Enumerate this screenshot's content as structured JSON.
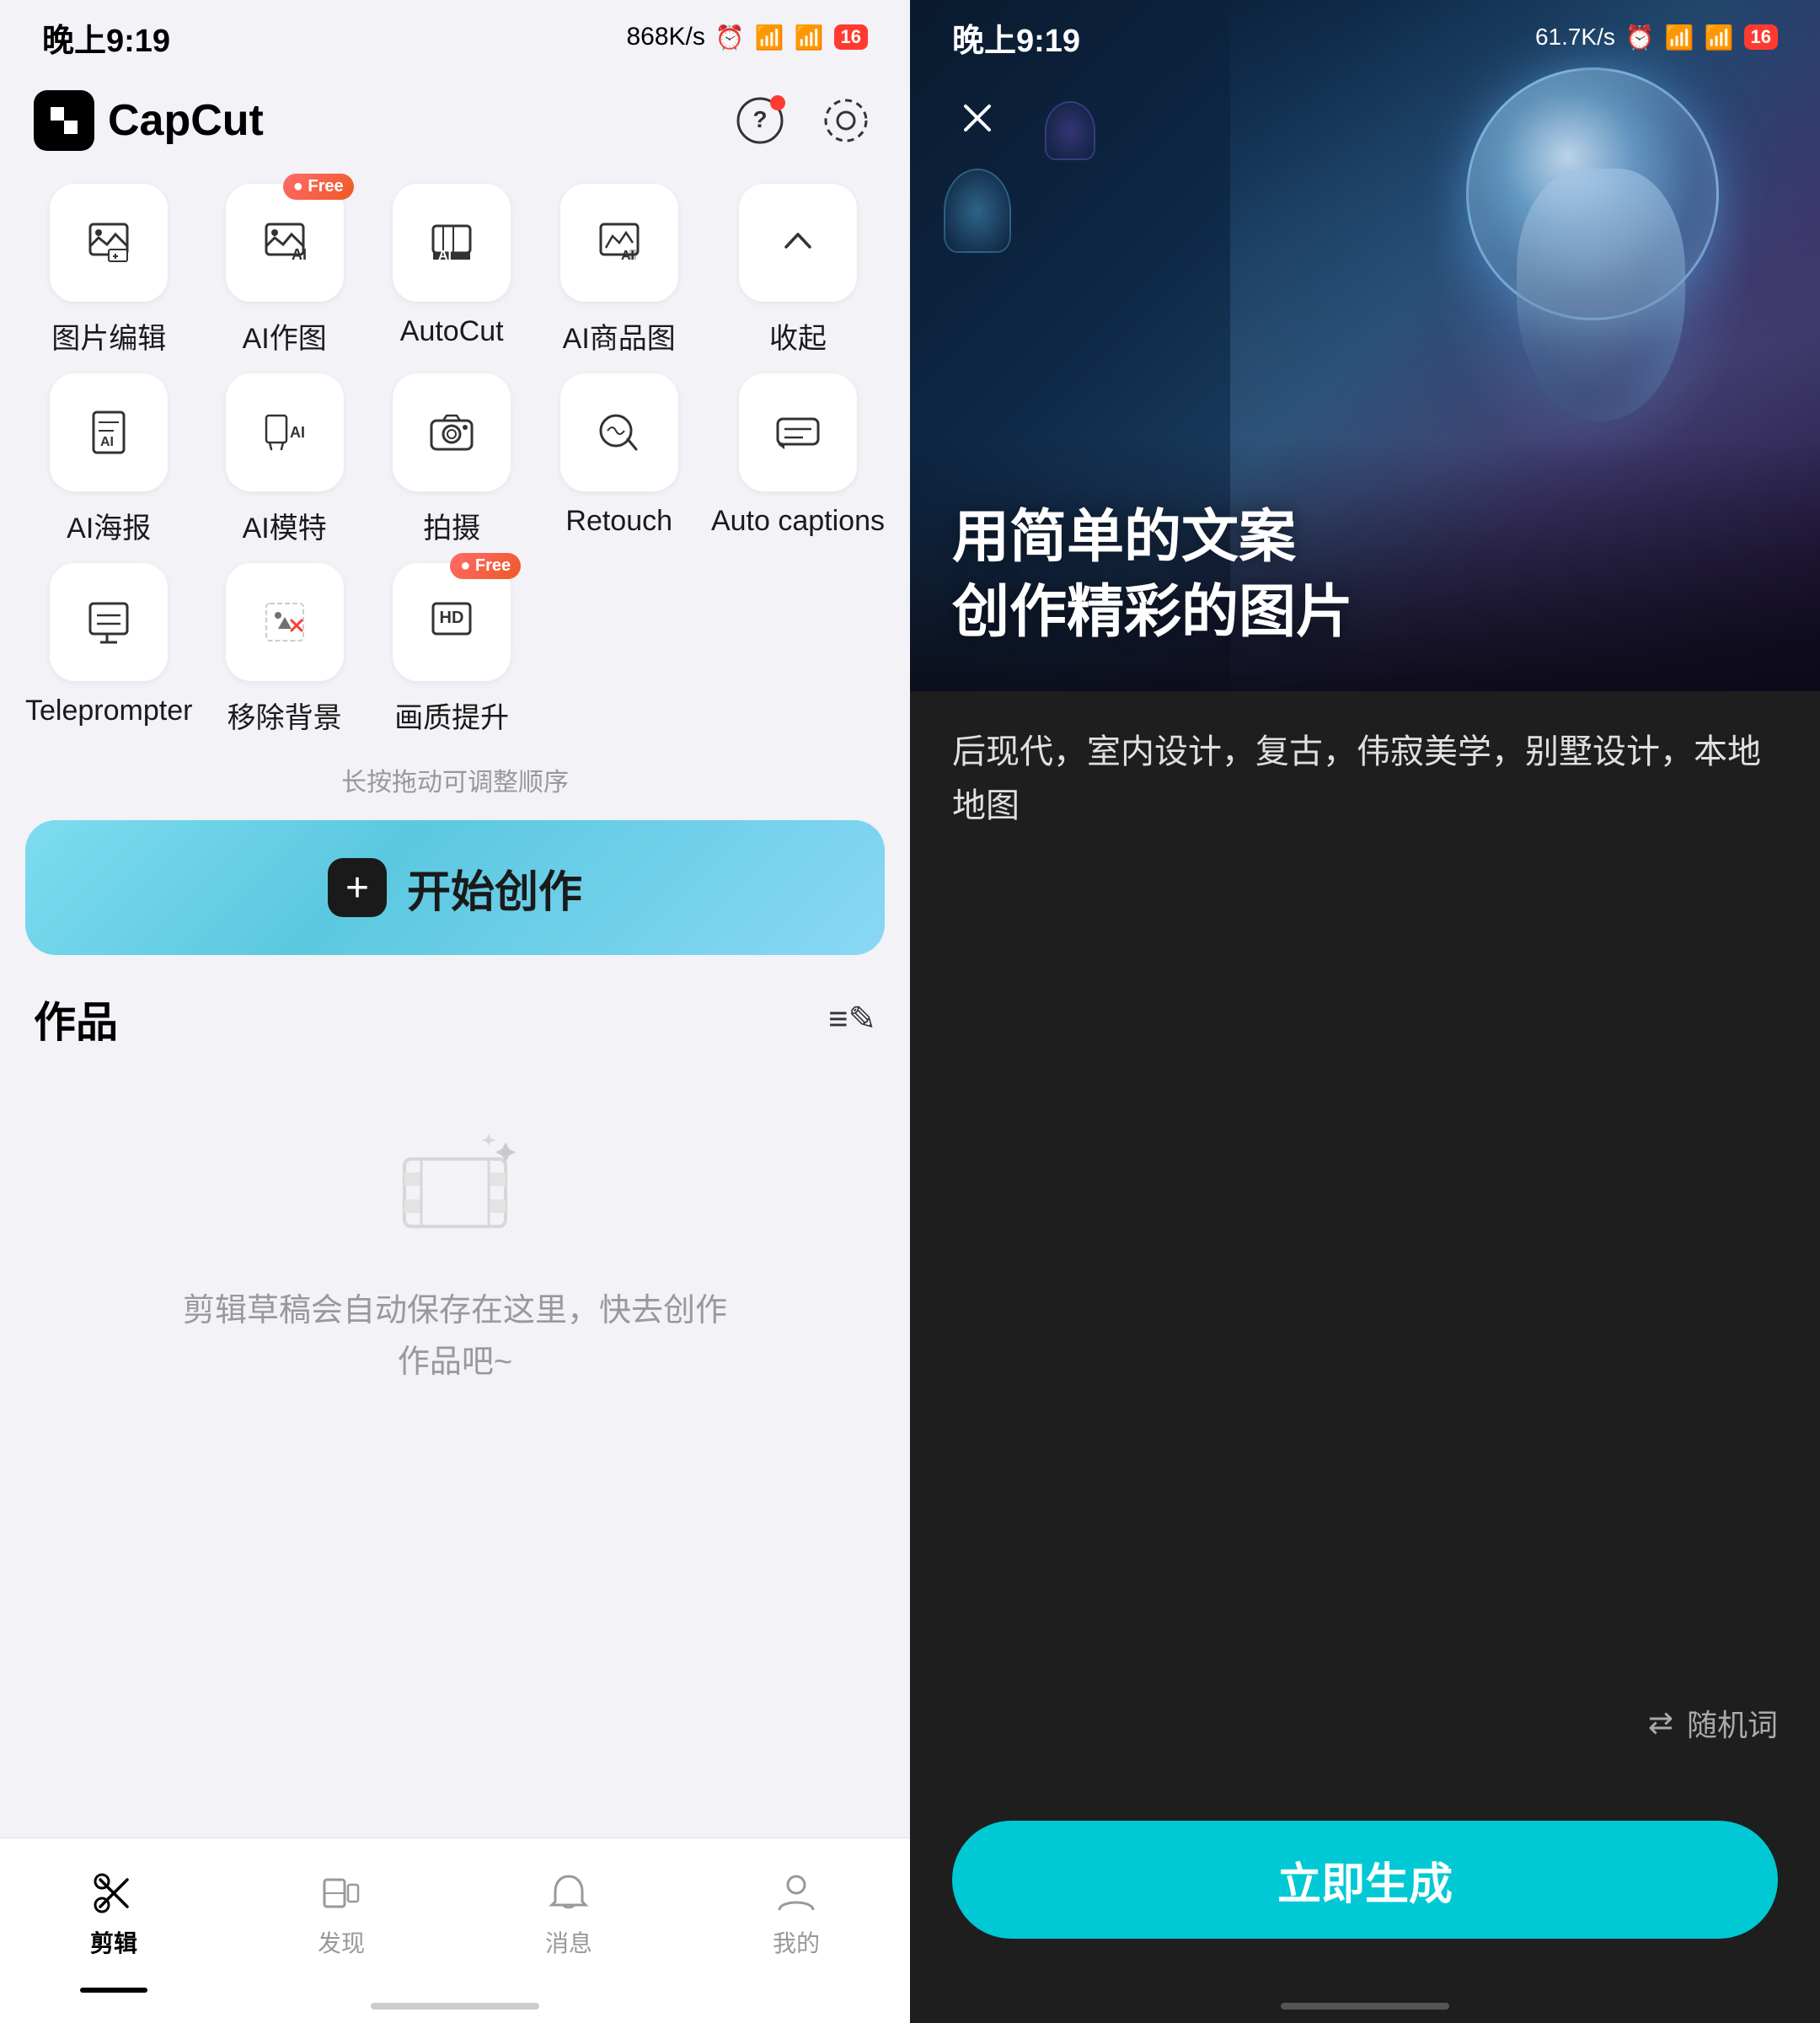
{
  "left": {
    "statusBar": {
      "time": "晚上9:19",
      "speed": "868K/s",
      "batteryBadge": "16"
    },
    "header": {
      "appName": "CapCut",
      "questionBtn": "?",
      "settingsBtn": "⊙"
    },
    "tools": [
      {
        "id": "image-edit",
        "label": "图片编辑",
        "icon": "image-edit",
        "free": false
      },
      {
        "id": "ai-painting",
        "label": "AI作图",
        "icon": "ai-painting",
        "free": true
      },
      {
        "id": "autocut",
        "label": "AutoCut",
        "icon": "autocut",
        "free": false
      },
      {
        "id": "ai-product",
        "label": "AI商品图",
        "icon": "ai-product",
        "free": false
      },
      {
        "id": "collapse",
        "label": "收起",
        "icon": "collapse",
        "free": false
      },
      {
        "id": "ai-poster",
        "label": "AI海报",
        "icon": "ai-poster",
        "free": false
      },
      {
        "id": "ai-model",
        "label": "AI模特",
        "icon": "ai-model",
        "free": false
      },
      {
        "id": "camera",
        "label": "拍摄",
        "icon": "camera",
        "free": false
      },
      {
        "id": "retouch",
        "label": "Retouch",
        "icon": "retouch",
        "free": false
      },
      {
        "id": "captions",
        "label": "Auto captions",
        "icon": "captions",
        "free": false
      },
      {
        "id": "teleprompter",
        "label": "Teleprompter",
        "icon": "teleprompter",
        "free": false
      },
      {
        "id": "remove-bg",
        "label": "移除背景",
        "icon": "remove-bg",
        "free": false
      },
      {
        "id": "enhance",
        "label": "画质提升",
        "icon": "enhance",
        "free": true
      }
    ],
    "dragHint": "长按拖动可调整顺序",
    "createBtn": "开始创作",
    "worksSection": {
      "title": "作品",
      "emptyText": "剪辑草稿会自动保存在这里，快去创作\n作品吧~"
    },
    "bottomNav": [
      {
        "id": "edit",
        "label": "剪辑",
        "active": true
      },
      {
        "id": "discover",
        "label": "发现",
        "active": false
      },
      {
        "id": "message",
        "label": "消息",
        "active": false
      },
      {
        "id": "profile",
        "label": "我的",
        "active": false
      }
    ]
  },
  "right": {
    "statusBar": {
      "time": "晚上9:19",
      "speed": "61.7K/s",
      "batteryBadge": "16"
    },
    "heroTitle": "用简单的文案\n创作精彩的图片",
    "promptText": "后现代，室内设计，复古，伟寂美学，别墅设计，本地地图",
    "randomLabel": "随机词",
    "generateBtn": "立即生成"
  }
}
